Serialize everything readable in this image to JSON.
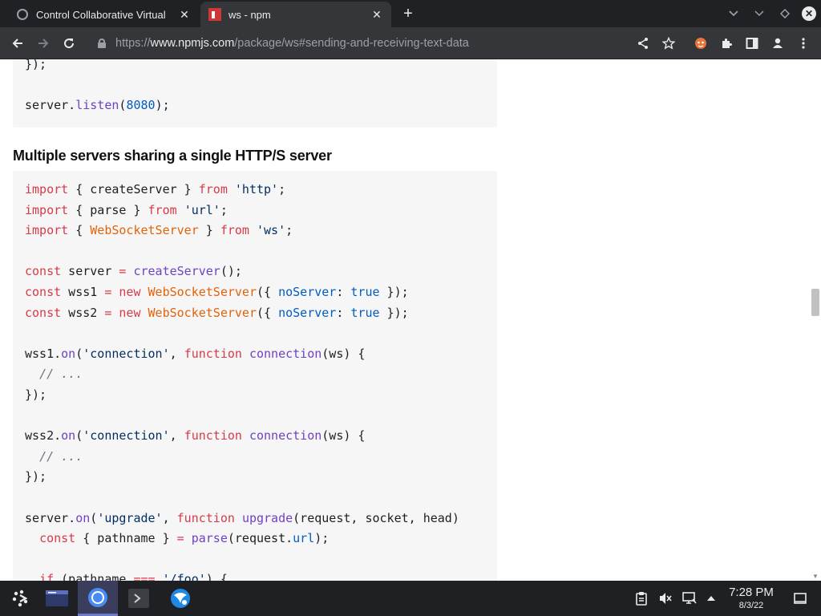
{
  "browser": {
    "tabs": [
      {
        "title": "Control Collaborative Virtual",
        "close": "✕"
      },
      {
        "title": "ws - npm",
        "close": "✕"
      }
    ],
    "new_tab": "+",
    "url": {
      "scheme": "https://",
      "host": "www.npmjs.com",
      "path": "/package/ws#sending-and-receiving-text-data"
    },
    "icons": [
      "back-icon",
      "forward-icon",
      "reload-icon",
      "lock-icon",
      "share-icon",
      "star-icon",
      "extension-icon",
      "puzzle-icon",
      "sidepanel-icon",
      "profile-icon",
      "menu-icon"
    ]
  },
  "page": {
    "top_code": [
      [
        {
          "t": "});"
        }
      ],
      [
        {
          "t": ""
        }
      ],
      [
        {
          "t": "server."
        },
        {
          "t": "listen",
          "c": "fn"
        },
        {
          "t": "("
        },
        {
          "t": "8080",
          "c": "num"
        },
        {
          "t": ");"
        }
      ]
    ],
    "heading": "Multiple servers sharing a single HTTP/S server",
    "main_code": [
      [
        {
          "t": "import",
          "c": "kw"
        },
        {
          "t": " { createServer } "
        },
        {
          "t": "from",
          "c": "kw"
        },
        {
          "t": " "
        },
        {
          "t": "'http'",
          "c": "str"
        },
        {
          "t": ";"
        }
      ],
      [
        {
          "t": "import",
          "c": "kw"
        },
        {
          "t": " { parse } "
        },
        {
          "t": "from",
          "c": "kw"
        },
        {
          "t": " "
        },
        {
          "t": "'url'",
          "c": "str"
        },
        {
          "t": ";"
        }
      ],
      [
        {
          "t": "import",
          "c": "kw"
        },
        {
          "t": " { "
        },
        {
          "t": "WebSocketServer",
          "c": "cls"
        },
        {
          "t": " } "
        },
        {
          "t": "from",
          "c": "kw"
        },
        {
          "t": " "
        },
        {
          "t": "'ws'",
          "c": "str"
        },
        {
          "t": ";"
        }
      ],
      [
        {
          "t": ""
        }
      ],
      [
        {
          "t": "const",
          "c": "kw"
        },
        {
          "t": " server "
        },
        {
          "t": "=",
          "c": "op"
        },
        {
          "t": " "
        },
        {
          "t": "createServer",
          "c": "fn"
        },
        {
          "t": "();"
        }
      ],
      [
        {
          "t": "const",
          "c": "kw"
        },
        {
          "t": " wss1 "
        },
        {
          "t": "=",
          "c": "op"
        },
        {
          "t": " "
        },
        {
          "t": "new",
          "c": "kw"
        },
        {
          "t": " "
        },
        {
          "t": "WebSocketServer",
          "c": "cls"
        },
        {
          "t": "({ "
        },
        {
          "t": "noServer",
          "c": "prop"
        },
        {
          "t": ": "
        },
        {
          "t": "true",
          "c": "num"
        },
        {
          "t": " });"
        }
      ],
      [
        {
          "t": "const",
          "c": "kw"
        },
        {
          "t": " wss2 "
        },
        {
          "t": "=",
          "c": "op"
        },
        {
          "t": " "
        },
        {
          "t": "new",
          "c": "kw"
        },
        {
          "t": " "
        },
        {
          "t": "WebSocketServer",
          "c": "cls"
        },
        {
          "t": "({ "
        },
        {
          "t": "noServer",
          "c": "prop"
        },
        {
          "t": ": "
        },
        {
          "t": "true",
          "c": "num"
        },
        {
          "t": " });"
        }
      ],
      [
        {
          "t": ""
        }
      ],
      [
        {
          "t": "wss1."
        },
        {
          "t": "on",
          "c": "fn"
        },
        {
          "t": "("
        },
        {
          "t": "'connection'",
          "c": "str"
        },
        {
          "t": ", "
        },
        {
          "t": "function",
          "c": "kw"
        },
        {
          "t": " "
        },
        {
          "t": "connection",
          "c": "fn"
        },
        {
          "t": "(ws) {"
        }
      ],
      [
        {
          "t": "  "
        },
        {
          "t": "// ...",
          "c": "cm"
        }
      ],
      [
        {
          "t": "});"
        }
      ],
      [
        {
          "t": ""
        }
      ],
      [
        {
          "t": "wss2."
        },
        {
          "t": "on",
          "c": "fn"
        },
        {
          "t": "("
        },
        {
          "t": "'connection'",
          "c": "str"
        },
        {
          "t": ", "
        },
        {
          "t": "function",
          "c": "kw"
        },
        {
          "t": " "
        },
        {
          "t": "connection",
          "c": "fn"
        },
        {
          "t": "(ws) {"
        }
      ],
      [
        {
          "t": "  "
        },
        {
          "t": "// ...",
          "c": "cm"
        }
      ],
      [
        {
          "t": "});"
        }
      ],
      [
        {
          "t": ""
        }
      ],
      [
        {
          "t": "server."
        },
        {
          "t": "on",
          "c": "fn"
        },
        {
          "t": "("
        },
        {
          "t": "'upgrade'",
          "c": "str"
        },
        {
          "t": ", "
        },
        {
          "t": "function",
          "c": "kw"
        },
        {
          "t": " "
        },
        {
          "t": "upgrade",
          "c": "fn"
        },
        {
          "t": "(request, socket, head)"
        }
      ],
      [
        {
          "t": "  "
        },
        {
          "t": "const",
          "c": "kw"
        },
        {
          "t": " { pathname } "
        },
        {
          "t": "=",
          "c": "op"
        },
        {
          "t": " "
        },
        {
          "t": "parse",
          "c": "fn"
        },
        {
          "t": "(request."
        },
        {
          "t": "url",
          "c": "prop"
        },
        {
          "t": ");"
        }
      ],
      [
        {
          "t": ""
        }
      ],
      [
        {
          "t": "  "
        },
        {
          "t": "if",
          "c": "kw"
        },
        {
          "t": " (pathname "
        },
        {
          "t": "===",
          "c": "op"
        },
        {
          "t": " "
        },
        {
          "t": "'/foo'",
          "c": "str"
        },
        {
          "t": ") {"
        }
      ]
    ]
  },
  "taskbar": {
    "apps": [
      "launcher-icon",
      "file-manager-icon",
      "chromium-icon",
      "terminal-icon",
      "browser-icon"
    ],
    "clock": {
      "time": "7:28 PM",
      "date": "8/3/22"
    }
  },
  "colors": {
    "keyword": "#d73a49",
    "string": "#032f62",
    "function": "#6f42c1",
    "class": "#e36209",
    "number": "#005cc5",
    "comment": "#6a737d",
    "code_bg": "#f6f6f6"
  }
}
